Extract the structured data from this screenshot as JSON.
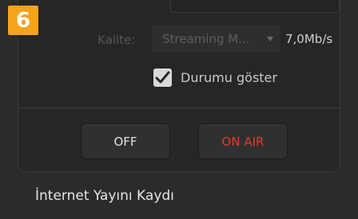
{
  "step": {
    "number": "6"
  },
  "stream": {
    "quality_label": "Kalite:",
    "quality_value": "Streaming M...",
    "bitrate": "7,0Mb/s"
  },
  "status": {
    "checkbox_label": "Durumu göster",
    "checked": true
  },
  "controls": {
    "off_label": "OFF",
    "on_air_label": "ON AIR"
  },
  "section": {
    "title": "İnternet Yayını Kaydı"
  },
  "colors": {
    "badge": "#f4a31b",
    "on_air": "#e33a2c",
    "background": "#2b2b2b"
  }
}
